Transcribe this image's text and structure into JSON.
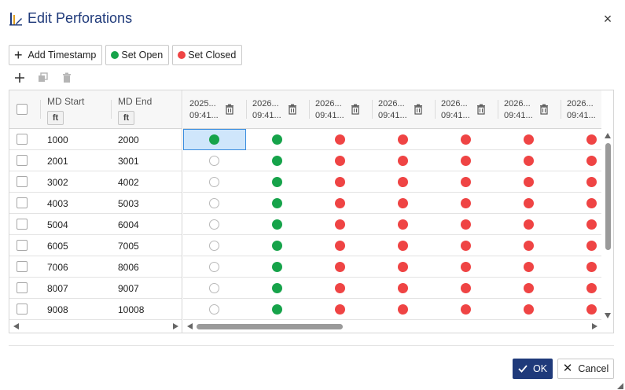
{
  "dialog": {
    "title": "Edit Perforations",
    "close_glyph": "×",
    "title_icon": "perforation-icon"
  },
  "toolbar": {
    "add_timestamp_label": "Add Timestamp",
    "set_open_label": "Set Open",
    "set_closed_label": "Set Closed",
    "open_color": "#16a34a",
    "closed_color": "#ef4444"
  },
  "mini_toolbar": {
    "icons": [
      "add-row-icon",
      "copy-icon",
      "delete-icon"
    ]
  },
  "grid": {
    "columns": {
      "md_start": {
        "label": "MD Start",
        "unit": "ft"
      },
      "md_end": {
        "label": "MD End",
        "unit": "ft"
      }
    },
    "timestamps": [
      {
        "date": "2025...",
        "time": "09:41..."
      },
      {
        "date": "2026...",
        "time": "09:41..."
      },
      {
        "date": "2026...",
        "time": "09:41..."
      },
      {
        "date": "2026...",
        "time": "09:41..."
      },
      {
        "date": "2026...",
        "time": "09:41..."
      },
      {
        "date": "2026...",
        "time": "09:41..."
      },
      {
        "date": "2026...",
        "time": "09:41..."
      }
    ],
    "rows": [
      {
        "md_start": "1000",
        "md_end": "2000",
        "states": [
          "open",
          "open",
          "closed",
          "closed",
          "closed",
          "closed",
          "closed"
        ]
      },
      {
        "md_start": "2001",
        "md_end": "3001",
        "states": [
          "unset",
          "open",
          "closed",
          "closed",
          "closed",
          "closed",
          "closed"
        ]
      },
      {
        "md_start": "3002",
        "md_end": "4002",
        "states": [
          "unset",
          "open",
          "closed",
          "closed",
          "closed",
          "closed",
          "closed"
        ]
      },
      {
        "md_start": "4003",
        "md_end": "5003",
        "states": [
          "unset",
          "open",
          "closed",
          "closed",
          "closed",
          "closed",
          "closed"
        ]
      },
      {
        "md_start": "5004",
        "md_end": "6004",
        "states": [
          "unset",
          "open",
          "closed",
          "closed",
          "closed",
          "closed",
          "closed"
        ]
      },
      {
        "md_start": "6005",
        "md_end": "7005",
        "states": [
          "unset",
          "open",
          "closed",
          "closed",
          "closed",
          "closed",
          "closed"
        ]
      },
      {
        "md_start": "7006",
        "md_end": "8006",
        "states": [
          "unset",
          "open",
          "closed",
          "closed",
          "closed",
          "closed",
          "closed"
        ]
      },
      {
        "md_start": "8007",
        "md_end": "9007",
        "states": [
          "unset",
          "open",
          "closed",
          "closed",
          "closed",
          "closed",
          "closed"
        ]
      },
      {
        "md_start": "9008",
        "md_end": "10008",
        "states": [
          "unset",
          "open",
          "closed",
          "closed",
          "closed",
          "closed",
          "closed"
        ]
      }
    ],
    "selected_row": 0,
    "selected_col": 0
  },
  "footer": {
    "ok_label": "OK",
    "cancel_label": "Cancel",
    "ok_color": "#1f3a7a"
  }
}
